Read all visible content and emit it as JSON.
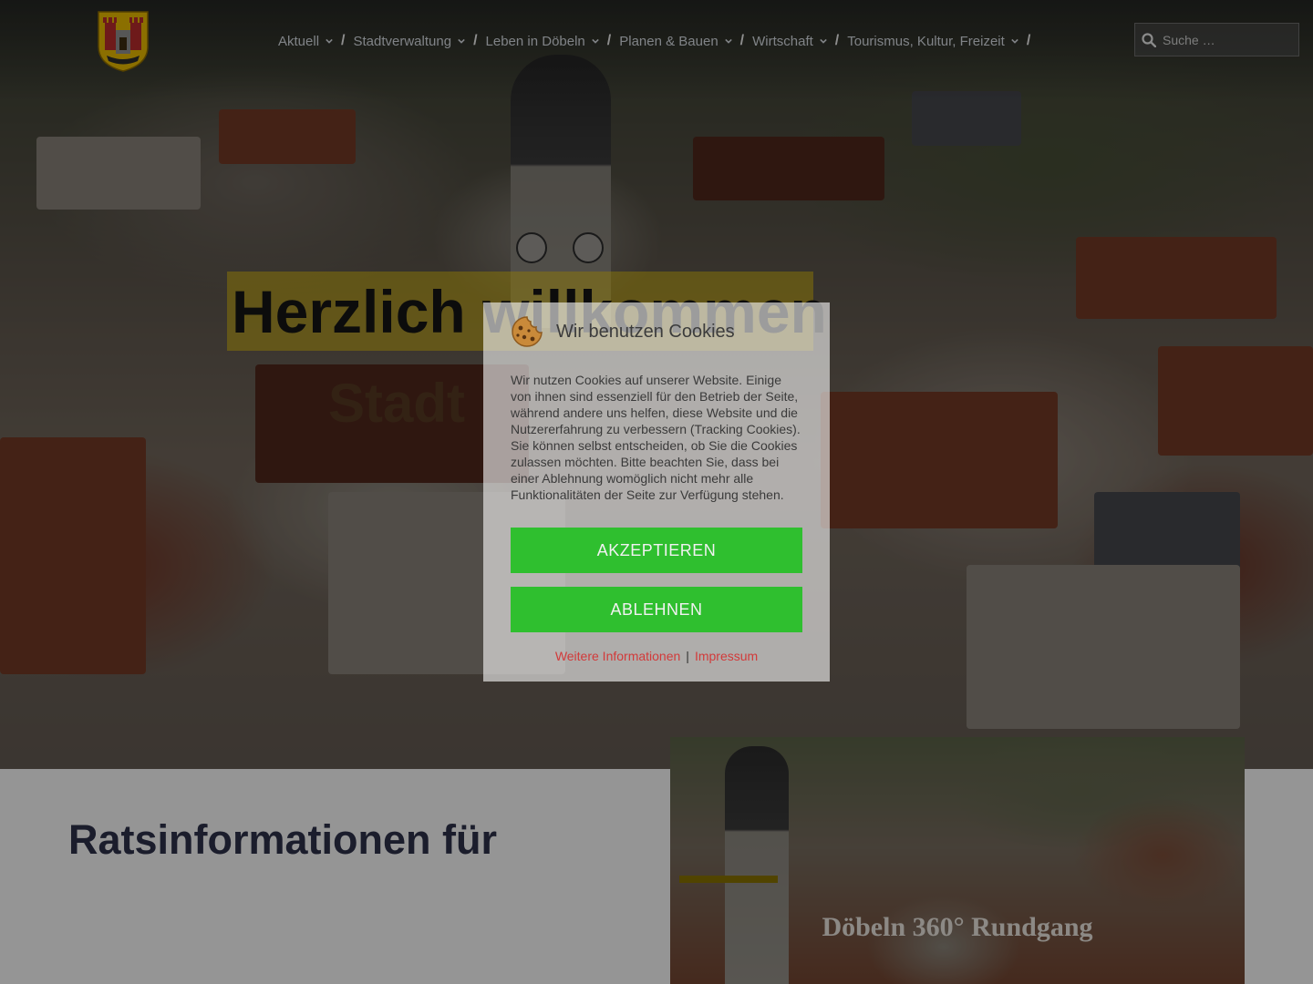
{
  "header": {
    "nav": [
      {
        "label": "Aktuell",
        "has_dropdown": true
      },
      {
        "label": "Stadtverwaltung",
        "has_dropdown": true
      },
      {
        "label": "Leben in Döbeln",
        "has_dropdown": true
      },
      {
        "label": "Planen & Bauen",
        "has_dropdown": true
      },
      {
        "label": "Wirtschaft",
        "has_dropdown": true
      },
      {
        "label": "Tourismus, Kultur, Freizeit",
        "has_dropdown": true
      }
    ],
    "nav_separator": "/",
    "search": {
      "placeholder": "Suche …",
      "icon": "search-icon"
    },
    "logo": {
      "icon": "coat-of-arms-icon"
    }
  },
  "hero": {
    "heading": "Herzlich willkommen",
    "subheading": "Stadt"
  },
  "main": {
    "section_title": "Ratsinformationen für",
    "card_title": "Döbeln 360° Rundgang"
  },
  "cookie": {
    "icon": "cookie-icon",
    "title": "Wir benutzen Cookies",
    "text": "Wir nutzen Cookies auf unserer Website. Einige von ihnen sind essenziell für den Betrieb der Seite, während andere uns helfen, diese Website und die Nutzererfahrung zu verbessern (Tracking Cookies). Sie können selbst entscheiden, ob Sie die Cookies zulassen möchten. Bitte beachten Sie, dass bei einer Ablehnung womöglich nicht mehr alle Funktionalitäten der Seite zur Verfügung stehen.",
    "accept_label": "AKZEPTIEREN",
    "decline_label": "ABLEHNEN",
    "more_info_label": "Weitere Informationen",
    "link_separator": "|",
    "imprint_label": "Impressum"
  },
  "colors": {
    "button_green": "#2fbf2f",
    "link_red": "#d23a3a",
    "heading_highlight": "#f0cd00",
    "title_navy": "#2c3048"
  }
}
